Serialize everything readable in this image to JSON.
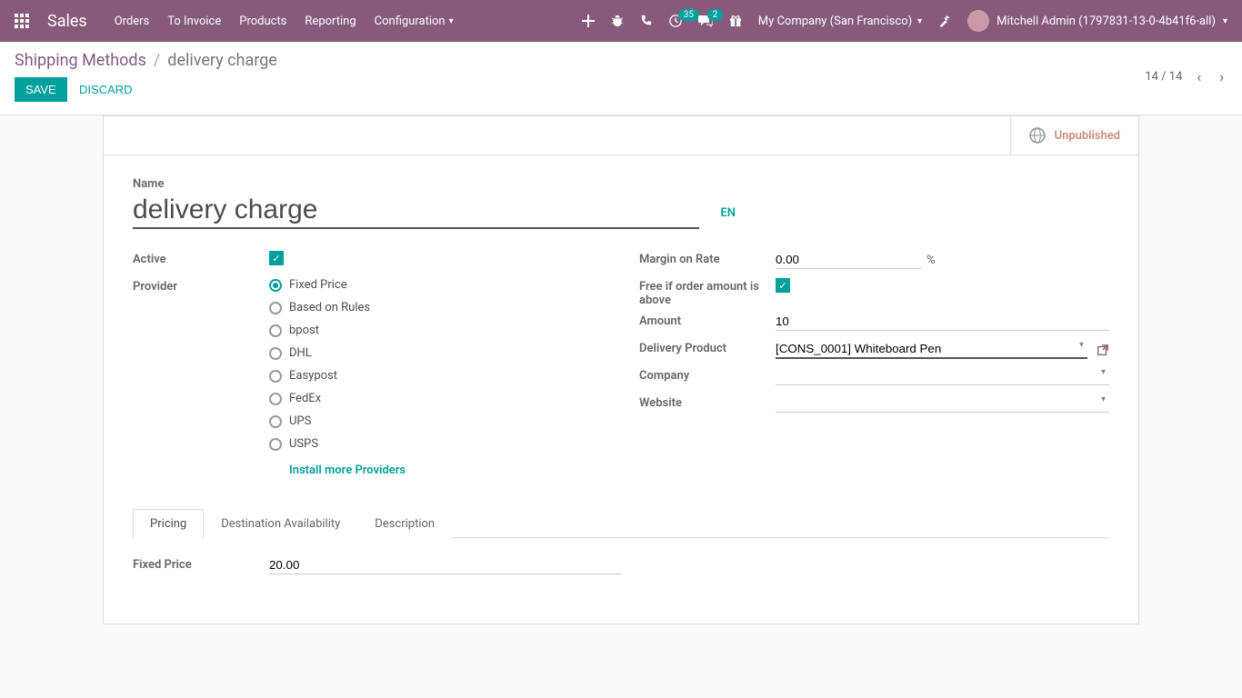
{
  "navbar": {
    "brand": "Sales",
    "menu": [
      "Orders",
      "To Invoice",
      "Products",
      "Reporting",
      "Configuration"
    ],
    "activities_badge": "35",
    "messages_badge": "2",
    "company": "My Company (San Francisco)",
    "user": "Mitchell Admin (1797831-13-0-4b41f6-all)"
  },
  "breadcrumb": {
    "parent": "Shipping Methods",
    "current": "delivery charge"
  },
  "buttons": {
    "save": "SAVE",
    "discard": "DISCARD"
  },
  "pager": "14 / 14",
  "status": {
    "unpublished": "Unpublished"
  },
  "form": {
    "name_label": "Name",
    "name_value": "delivery charge",
    "lang": "EN",
    "left": {
      "active_label": "Active",
      "provider_label": "Provider",
      "providers": [
        "Fixed Price",
        "Based on Rules",
        "bpost",
        "DHL",
        "Easypost",
        "FedEx",
        "UPS",
        "USPS"
      ],
      "install_link": "Install more Providers"
    },
    "right": {
      "margin_label": "Margin on Rate",
      "margin_value": "0.00",
      "margin_suffix": "%",
      "free_label": "Free if order amount is above",
      "amount_label": "Amount",
      "amount_value": "10",
      "delivery_product_label": "Delivery Product",
      "delivery_product_value": "[CONS_0001] Whiteboard Pen",
      "company_label": "Company",
      "company_value": "",
      "website_label": "Website",
      "website_value": ""
    }
  },
  "tabs": {
    "pricing": "Pricing",
    "destination": "Destination Availability",
    "description": "Description"
  },
  "tab_content": {
    "fixed_price_label": "Fixed Price",
    "fixed_price_value": "20.00"
  }
}
